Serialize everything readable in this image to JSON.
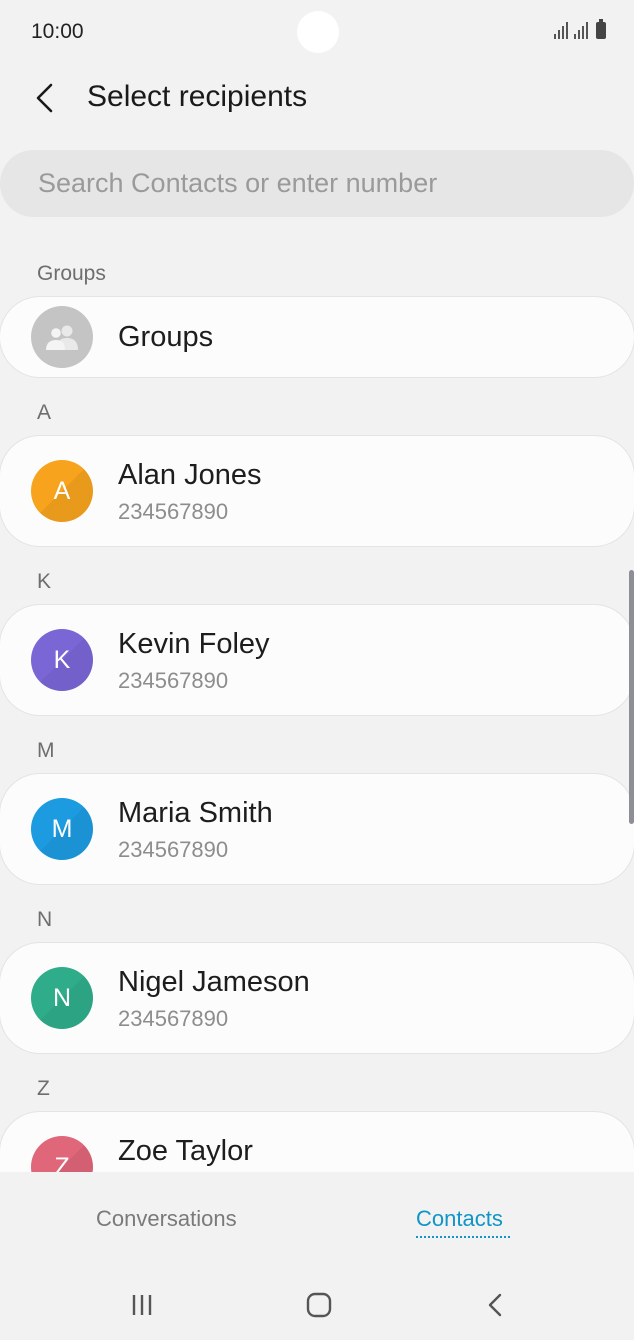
{
  "status_bar": {
    "time": "10:00"
  },
  "header": {
    "title": "Select recipients"
  },
  "search": {
    "placeholder": "Search Contacts or enter number"
  },
  "sections": {
    "groups": "Groups",
    "a": "A",
    "k": "K",
    "m": "M",
    "n": "N",
    "z": "Z"
  },
  "groups_item": {
    "label": "Groups"
  },
  "contacts": [
    {
      "name": "Alan Jones",
      "number": "234567890",
      "initial": "A",
      "color": "#f7a31d"
    },
    {
      "name": "Kevin Foley",
      "number": "234567890",
      "initial": "K",
      "color": "#7b66d6"
    },
    {
      "name": "Maria Smith",
      "number": "234567890",
      "initial": "M",
      "color": "#1c9be0"
    },
    {
      "name": "Nigel Jameson",
      "number": "234567890",
      "initial": "N",
      "color": "#2fad8b"
    },
    {
      "name": "Zoe Taylor",
      "number": "",
      "initial": "Z",
      "color": "#e06679"
    }
  ],
  "tabs": {
    "conversations": "Conversations",
    "contacts": "Contacts"
  },
  "colors": {
    "accent": "#0f95c7",
    "background": "#f2f2f2"
  }
}
